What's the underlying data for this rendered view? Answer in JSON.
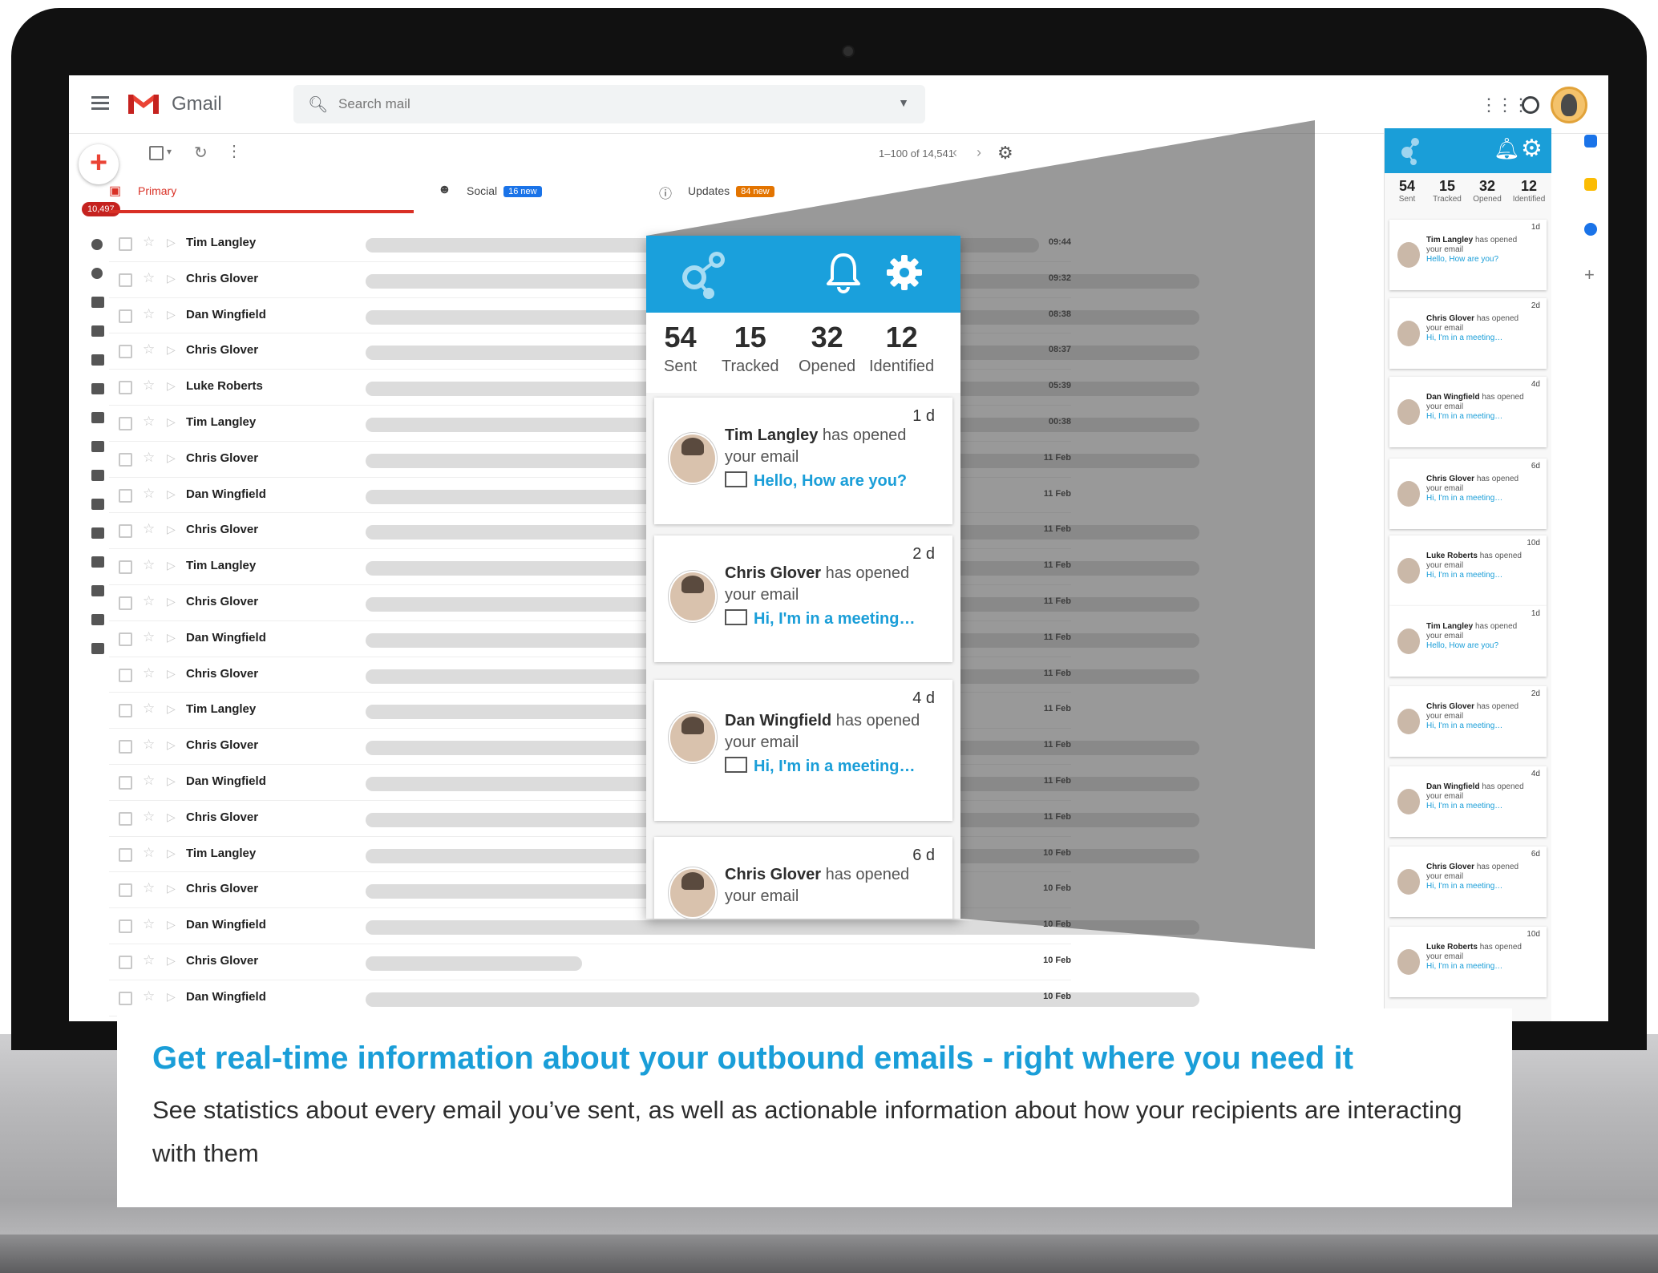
{
  "gmail": {
    "app_name": "Gmail",
    "search_placeholder": "Search mail",
    "unread_count": "10,497",
    "pager_text": "1–100 of 14,541",
    "tabs": [
      {
        "label": "Primary"
      },
      {
        "label": "Social",
        "badge": "16 new",
        "badge_color": "#1a73e8"
      },
      {
        "label": "Updates",
        "badge": "84 new",
        "badge_color": "#e37400"
      }
    ],
    "rows": [
      {
        "sender": "Tim Langley",
        "time": "09:44"
      },
      {
        "sender": "Chris Glover",
        "time": "09:32"
      },
      {
        "sender": "Dan Wingfield",
        "time": "08:38"
      },
      {
        "sender": "Chris Glover",
        "time": "08:37"
      },
      {
        "sender": "Luke Roberts",
        "time": "05:39"
      },
      {
        "sender": "Tim Langley",
        "time": "00:38"
      },
      {
        "sender": "Chris Glover",
        "time": "11 Feb"
      },
      {
        "sender": "Dan Wingfield",
        "time": "11 Feb"
      },
      {
        "sender": "Chris Glover",
        "time": "11 Feb"
      },
      {
        "sender": "Tim Langley",
        "time": "11 Feb"
      },
      {
        "sender": "Chris Glover",
        "time": "11 Feb"
      },
      {
        "sender": "Dan Wingfield",
        "time": "11 Feb"
      },
      {
        "sender": "Chris Glover",
        "time": "11 Feb"
      },
      {
        "sender": "Tim Langley",
        "time": "11 Feb"
      },
      {
        "sender": "Chris Glover",
        "time": "11 Feb"
      },
      {
        "sender": "Dan Wingfield",
        "time": "11 Feb"
      },
      {
        "sender": "Chris Glover",
        "time": "11 Feb"
      },
      {
        "sender": "Tim Langley",
        "time": "10 Feb"
      },
      {
        "sender": "Chris Glover",
        "time": "10 Feb"
      },
      {
        "sender": "Dan Wingfield",
        "time": "10 Feb"
      },
      {
        "sender": "Chris Glover",
        "time": "10 Feb"
      },
      {
        "sender": "Dan Wingfield",
        "time": "10 Feb"
      }
    ]
  },
  "tracker": {
    "brand_color": "#1a9ed8",
    "stats": [
      {
        "value": "54",
        "label": "Sent"
      },
      {
        "value": "15",
        "label": "Tracked"
      },
      {
        "value": "32",
        "label": "Opened"
      },
      {
        "value": "12",
        "label": "Identified"
      }
    ],
    "action_text": "has opened",
    "object_text": "your email",
    "popup_cards": [
      {
        "name": "Tim Langley",
        "age": "1 d",
        "subject": "Hello, How are you?"
      },
      {
        "name": "Chris Glover",
        "age": "2 d",
        "subject": "Hi, I'm in a meeting…"
      },
      {
        "name": "Dan Wingfield",
        "age": "4 d",
        "subject": "Hi, I'm in a meeting…"
      },
      {
        "name": "Chris Glover",
        "age": "6 d",
        "subject": ""
      }
    ],
    "side_cards": [
      {
        "name": "Tim Langley",
        "age": "1d",
        "subject": "Hello, How are you?"
      },
      {
        "name": "Chris Glover",
        "age": "2d",
        "subject": "Hi, I'm in a meeting…"
      },
      {
        "name": "Dan Wingfield",
        "age": "4d",
        "subject": "Hi, I'm in a meeting…"
      },
      {
        "name": "Chris Glover",
        "age": "6d",
        "subject": "Hi, I'm in a meeting…"
      },
      {
        "name": "Luke Roberts",
        "age": "10d",
        "subject": "Hi, I'm in a meeting…"
      },
      {
        "name": "Tim Langley",
        "age": "1d",
        "subject": "Hello, How are you?"
      },
      {
        "name": "Chris Glover",
        "age": "2d",
        "subject": "Hi, I'm in a meeting…"
      },
      {
        "name": "Dan Wingfield",
        "age": "4d",
        "subject": "Hi, I'm in a meeting…"
      },
      {
        "name": "Chris Glover",
        "age": "6d",
        "subject": "Hi, I'm in a meeting…"
      },
      {
        "name": "Luke Roberts",
        "age": "10d",
        "subject": "Hi, I'm in a meeting…"
      }
    ]
  },
  "caption": {
    "title": "Get real-time information about your outbound emails - right where you need it",
    "body": "See statistics about every email you’ve sent, as well as actionable information about how your recipients are interacting with them"
  }
}
